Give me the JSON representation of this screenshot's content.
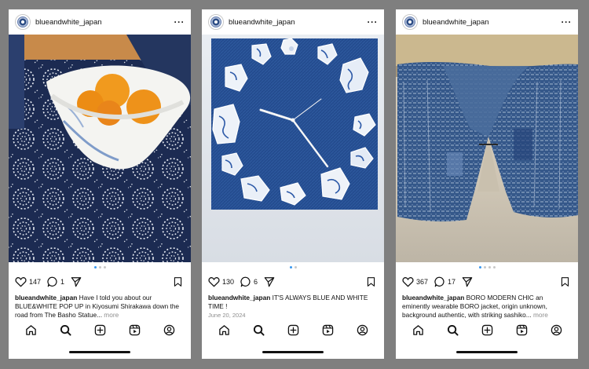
{
  "posts": [
    {
      "username": "blueandwhite_japan",
      "likes": "147",
      "comments": "1",
      "caption_user": "blueandwhite_japan",
      "caption_text": " Have I told you about our BLUE&WHITE POP UP in Kiyosumi Shirakawa down the road from The Basho Statue...",
      "caption_more": " more",
      "date": ""
    },
    {
      "username": "blueandwhite_japan",
      "likes": "130",
      "comments": "6",
      "caption_user": "blueandwhite_japan",
      "caption_text": " IT'S ALWAYS BLUE AND WHITE TIME !",
      "caption_more": "",
      "date": "June 20, 2024"
    },
    {
      "username": "blueandwhite_japan",
      "likes": "367",
      "comments": "17",
      "caption_user": "blueandwhite_japan",
      "caption_text": " BORO MODERN CHIC  an eminently wearable BORO jacket, origin unknown, background authentic, with striking sashiko...",
      "caption_more": " more",
      "date": ""
    }
  ],
  "icons": {
    "header": [
      "avatar",
      "more-icon"
    ],
    "actions": [
      "heart-icon",
      "comment-icon",
      "share-icon",
      "bookmark-icon"
    ],
    "nav": [
      "home-icon",
      "search-icon",
      "create-icon",
      "reels-icon",
      "profile-icon"
    ]
  },
  "colors": {
    "accent_dot": "#3897f0",
    "background": "#7f7f7f"
  }
}
